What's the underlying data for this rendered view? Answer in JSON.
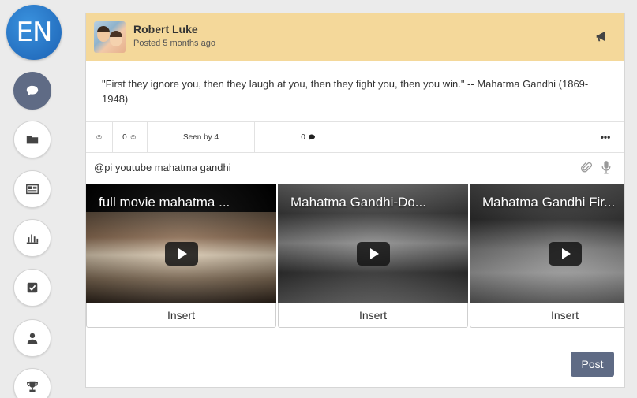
{
  "app": {
    "logo_text": "EN"
  },
  "sidebar": {
    "items": [
      {
        "name": "chat-icon",
        "active": true
      },
      {
        "name": "folder-icon",
        "active": false
      },
      {
        "name": "newspaper-icon",
        "active": false
      },
      {
        "name": "bar-chart-icon",
        "active": false
      },
      {
        "name": "checkbox-icon",
        "active": false
      },
      {
        "name": "user-icon",
        "active": false
      },
      {
        "name": "trophy-icon",
        "active": false
      }
    ]
  },
  "post": {
    "author": "Robert Luke",
    "posted": "Posted 5 months ago",
    "quote": "\"First they ignore you, then they laugh at you, then they fight you, then you win.\" -- Mahatma Gandhi (1869-1948)",
    "header_color": "#f4d89a",
    "stats": {
      "reactions": "0",
      "seen_by": "Seen by 4",
      "comments": "0",
      "more": "•••"
    }
  },
  "composer": {
    "text": "@pi youtube mahatma gandhi"
  },
  "videos": [
    {
      "title": "full movie mahatma ...",
      "insert_label": "Insert"
    },
    {
      "title": "Mahatma Gandhi-Do...",
      "insert_label": "Insert"
    },
    {
      "title": "Mahatma Gandhi Fir...",
      "insert_label": "Insert"
    }
  ],
  "actions": {
    "post_label": "Post",
    "accent": "#5f6b85"
  }
}
